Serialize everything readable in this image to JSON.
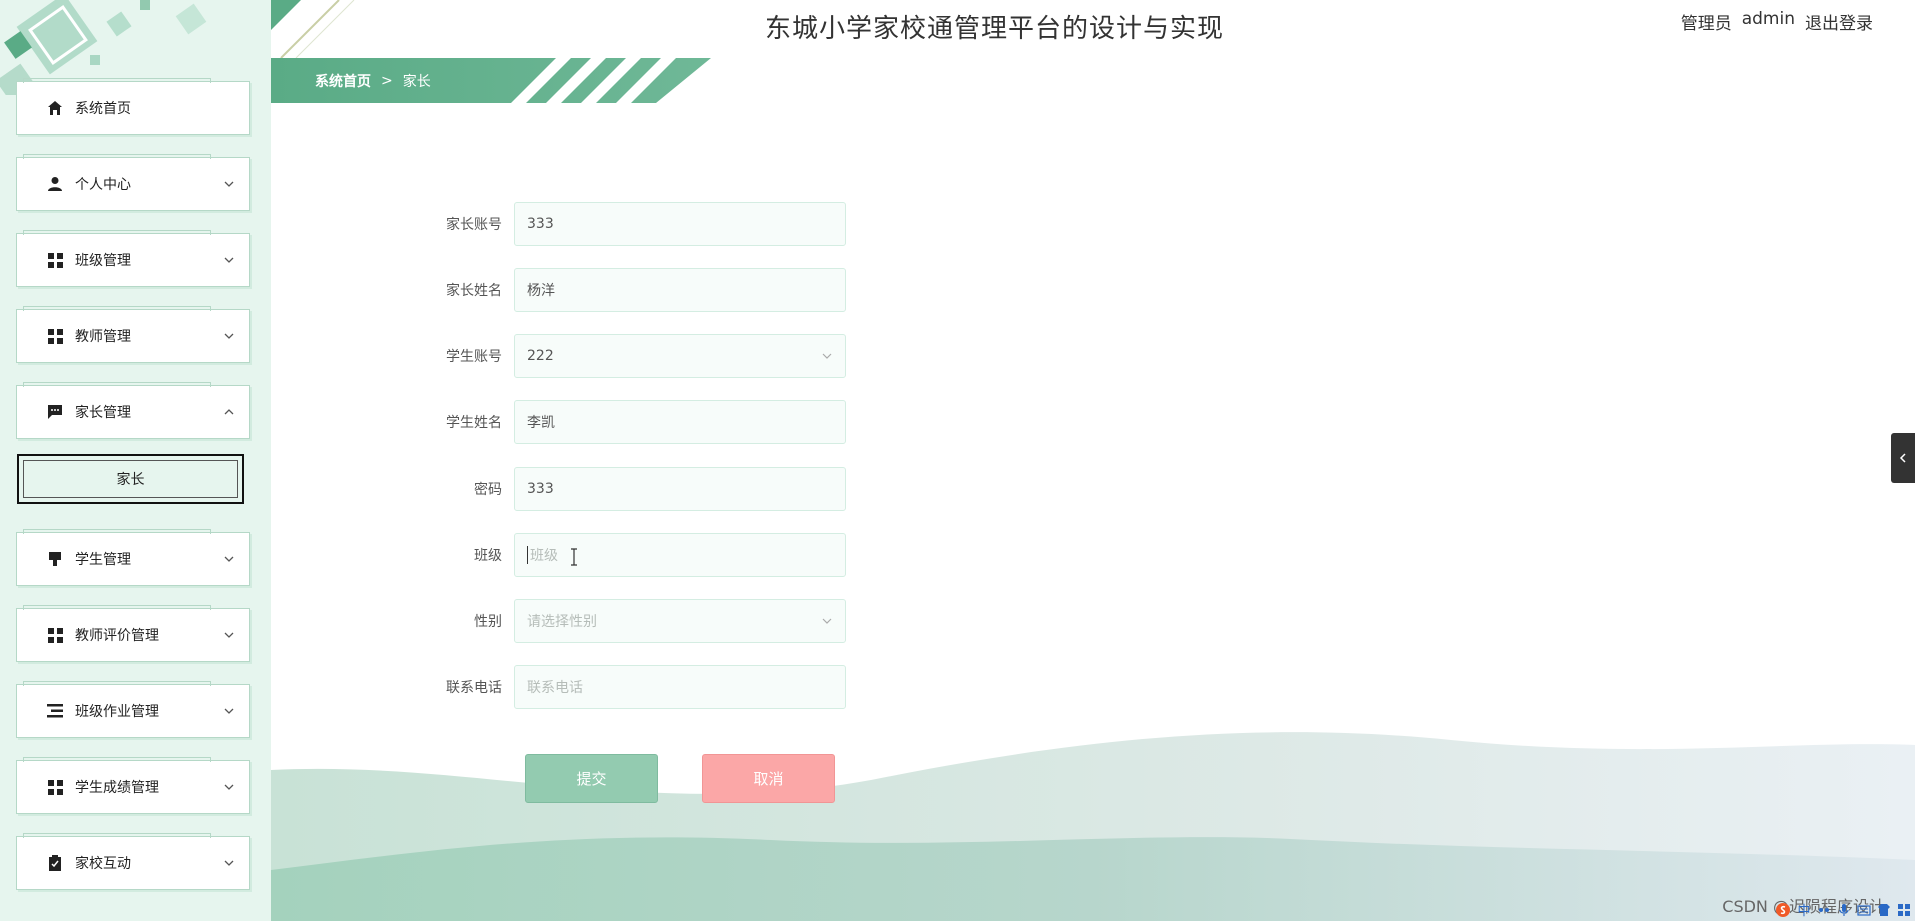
{
  "header": {
    "title": "东城小学家校通管理平台的设计与实现",
    "user_role": "管理员",
    "user_name": "admin",
    "logout_label": "退出登录"
  },
  "breadcrumb": {
    "home": "系统首页",
    "separator": ">",
    "current": "家长"
  },
  "sidebar": {
    "items": [
      {
        "label": "系统首页",
        "icon": "home-icon"
      },
      {
        "label": "个人中心",
        "icon": "user-icon"
      },
      {
        "label": "班级管理",
        "icon": "grid-icon"
      },
      {
        "label": "教师管理",
        "icon": "grid-icon"
      },
      {
        "label": "家长管理",
        "icon": "chat-icon",
        "expanded": true
      },
      {
        "label": "学生管理",
        "icon": "brush-icon"
      },
      {
        "label": "教师评价管理",
        "icon": "grid-icon"
      },
      {
        "label": "班级作业管理",
        "icon": "list-icon"
      },
      {
        "label": "学生成绩管理",
        "icon": "grid-icon"
      },
      {
        "label": "家校互动",
        "icon": "clipboard-icon"
      }
    ],
    "submenu": {
      "label": "家长"
    }
  },
  "form": {
    "fields": [
      {
        "label": "家长账号",
        "value": "333",
        "placeholder": ""
      },
      {
        "label": "家长姓名",
        "value": "杨洋",
        "placeholder": ""
      },
      {
        "label": "学生账号",
        "value": "222",
        "placeholder": "",
        "type": "select"
      },
      {
        "label": "学生姓名",
        "value": "李凯",
        "placeholder": ""
      },
      {
        "label": "密码",
        "value": "333",
        "placeholder": ""
      },
      {
        "label": "班级",
        "value": "",
        "placeholder": "班级"
      },
      {
        "label": "性别",
        "value": "",
        "placeholder": "请选择性别",
        "type": "select"
      },
      {
        "label": "联系电话",
        "value": "",
        "placeholder": "联系电话"
      }
    ],
    "submit_label": "提交",
    "cancel_label": "取消"
  },
  "watermark": "CSDN @迟陨程序设计",
  "taskbar": {
    "input_lang": "中"
  },
  "colors": {
    "primary": "#5aab86",
    "sidebar_bg": "#e6f5ee",
    "submit": "#93cbb0",
    "cancel": "#fba7a7"
  }
}
